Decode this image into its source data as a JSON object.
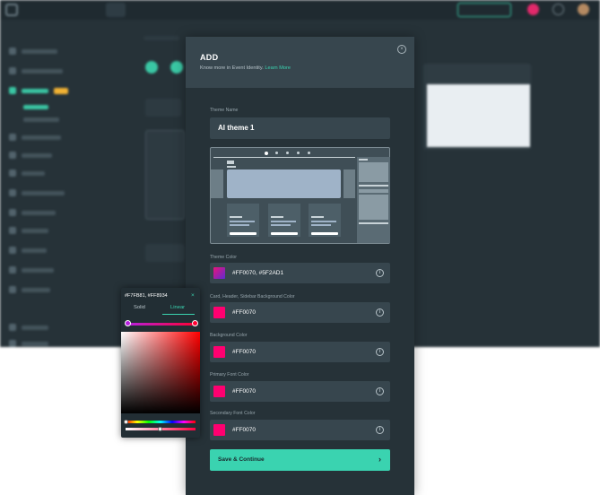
{
  "modal": {
    "title": "ADD",
    "subtitle": "Know more in Event Identity.",
    "learn_more": "Learn More",
    "theme_name_label": "Theme Name",
    "theme_name_value": "AI theme 1",
    "save_label": "Save & Continue",
    "save_arrow": "›",
    "close_glyph": "×",
    "fields": [
      {
        "label": "Theme Color",
        "value": "#FF0070, #5F2AD1",
        "swatch": "gradient",
        "colors": [
          "#e9147a",
          "#5f2ad1"
        ]
      },
      {
        "label": "Card, Header, Sidebar Background Color",
        "value": "#FF0070",
        "swatch": "solid",
        "colors": [
          "#ff0070"
        ]
      },
      {
        "label": "Background Color",
        "value": "#FF0070",
        "swatch": "solid",
        "colors": [
          "#ff0070"
        ]
      },
      {
        "label": "Primary Font Color",
        "value": "#FF0070",
        "swatch": "solid",
        "colors": [
          "#ff0070"
        ]
      },
      {
        "label": "Secondary Font Color",
        "value": "#FF0070",
        "swatch": "solid",
        "colors": [
          "#ff0070"
        ]
      }
    ],
    "info_glyph": "i"
  },
  "picker": {
    "value": "#F7FB81, #FF8934",
    "close_glyph": "×",
    "tabs": [
      "Solid",
      "Linear"
    ],
    "active_tab": "Linear"
  },
  "background_app": {
    "accent": "#3ac7a4"
  }
}
